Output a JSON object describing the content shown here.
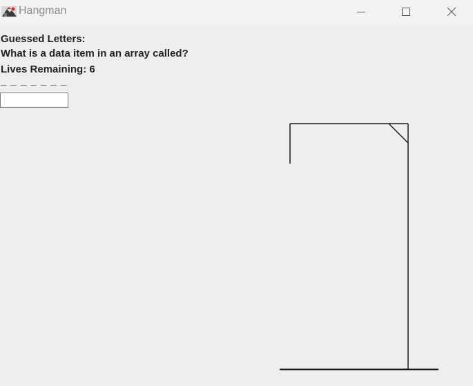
{
  "window": {
    "title": "Hangman",
    "controls": {
      "minimize": "minimize-icon",
      "maximize": "maximize-icon",
      "close": "close-icon"
    }
  },
  "game": {
    "guessed_letters_label": "Guessed Letters:",
    "question": "What is a data item in an array called?",
    "lives_label": "Lives Remaining: 6",
    "word_display": "_ _ _ _ _ _ _",
    "guess_input_value": "",
    "colors": {
      "background": "#eeeeee",
      "text": "#222222",
      "gallows": "#1a1a1a"
    }
  }
}
